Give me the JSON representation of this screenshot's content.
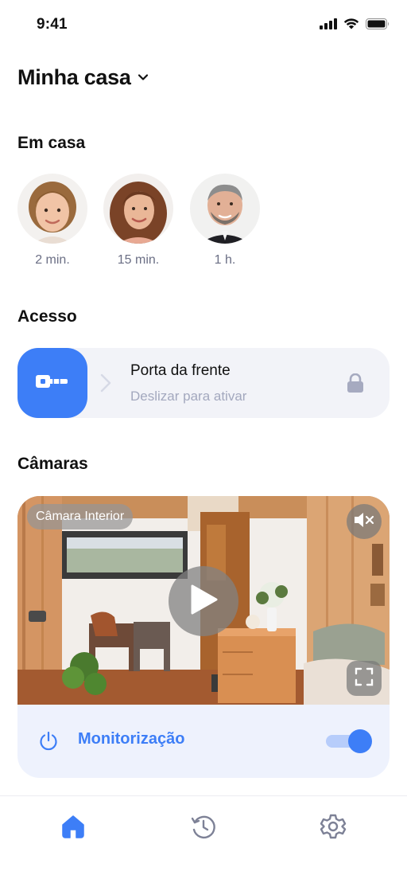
{
  "status_bar": {
    "time": "9:41",
    "icons": [
      "signal-icon",
      "wifi-icon",
      "battery-icon"
    ]
  },
  "header": {
    "title": "Minha casa",
    "icon": "chevron-down-icon"
  },
  "home_section": {
    "title": "Em casa",
    "members": [
      {
        "avatar": "child-avatar",
        "time": "2 min."
      },
      {
        "avatar": "woman-avatar",
        "time": "15 min."
      },
      {
        "avatar": "man-avatar",
        "time": "1 h."
      }
    ]
  },
  "access_section": {
    "title": "Acesso",
    "door_name": "Porta da frente",
    "slide_hint": "Deslizar para ativar",
    "icons": [
      "key-icon",
      "chevron-right-icon",
      "lock-icon"
    ]
  },
  "cameras_section": {
    "title": "Câmaras",
    "camera_name": "Câmara Interior",
    "icons": [
      "mute-icon",
      "play-icon",
      "fullscreen-icon"
    ],
    "monitoring_label": "Monitorização",
    "monitoring_enabled": true
  },
  "tab_bar": {
    "tabs": [
      {
        "icon": "home-icon",
        "active": true
      },
      {
        "icon": "history-icon",
        "active": false
      },
      {
        "icon": "settings-icon",
        "active": false
      }
    ]
  },
  "colors": {
    "accent": "#3d7ef7",
    "accent_light": "#b7cdfb",
    "card_bg": "#f2f3f8",
    "monitor_bg": "#eef2fd",
    "muted_text": "#6b6f85",
    "hint_text": "#a3a8be",
    "inactive_icon": "#7d8196"
  }
}
